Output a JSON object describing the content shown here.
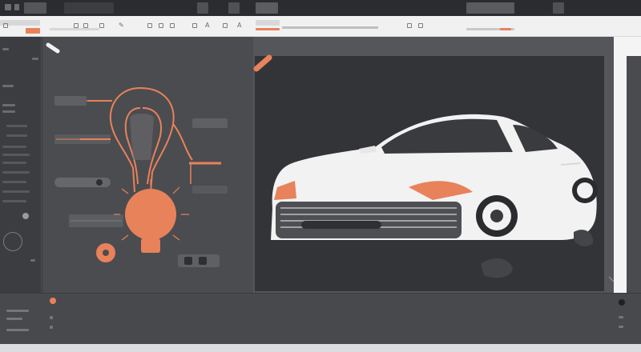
{
  "colors": {
    "accent": "#e8825a",
    "bg_dark": "#333438",
    "panel": "#4b4c50",
    "toolbar": "#f1f1f2",
    "car_body": "#f2f2f2"
  },
  "icons": {
    "menu": "menu-icon",
    "pen": "pen-icon",
    "text": "text-tool-icon",
    "color": "color-swatch-icon",
    "settings": "settings-icon"
  }
}
